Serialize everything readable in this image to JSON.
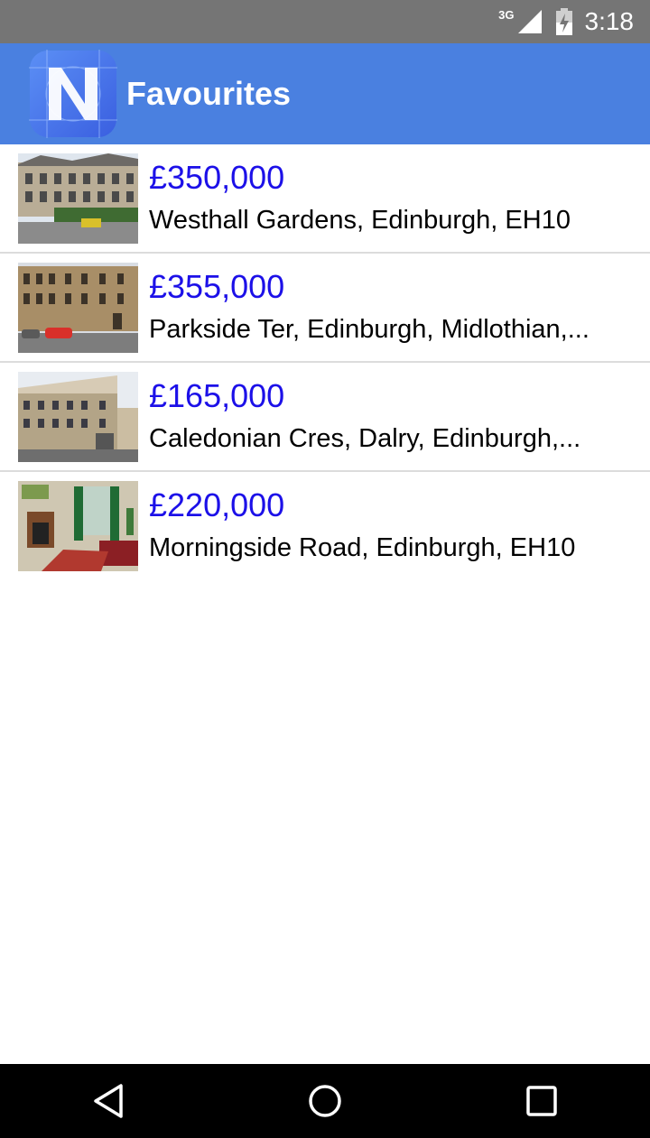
{
  "status_bar": {
    "network": "3G",
    "time": "3:18",
    "icons": [
      "signal-icon",
      "battery-icon"
    ]
  },
  "app_bar": {
    "title": "Favourites",
    "logo_icon": "nativescript-logo",
    "color": "#4a80e0"
  },
  "listings": [
    {
      "price": "£350,000",
      "address": "Westhall Gardens, Edinburgh, EH10"
    },
    {
      "price": "£355,000",
      "address": "Parkside Ter, Edinburgh, Midlothian,..."
    },
    {
      "price": "£165,000",
      "address": "Caledonian Cres, Dalry, Edinburgh,..."
    },
    {
      "price": "£220,000",
      "address": "Morningside Road, Edinburgh, EH10"
    }
  ],
  "nav_bar": {
    "icons": [
      "back-icon",
      "home-icon",
      "recents-icon"
    ]
  },
  "colors": {
    "price": "#1c10e8",
    "status_bar": "#757575",
    "nav_bar": "#000000"
  }
}
